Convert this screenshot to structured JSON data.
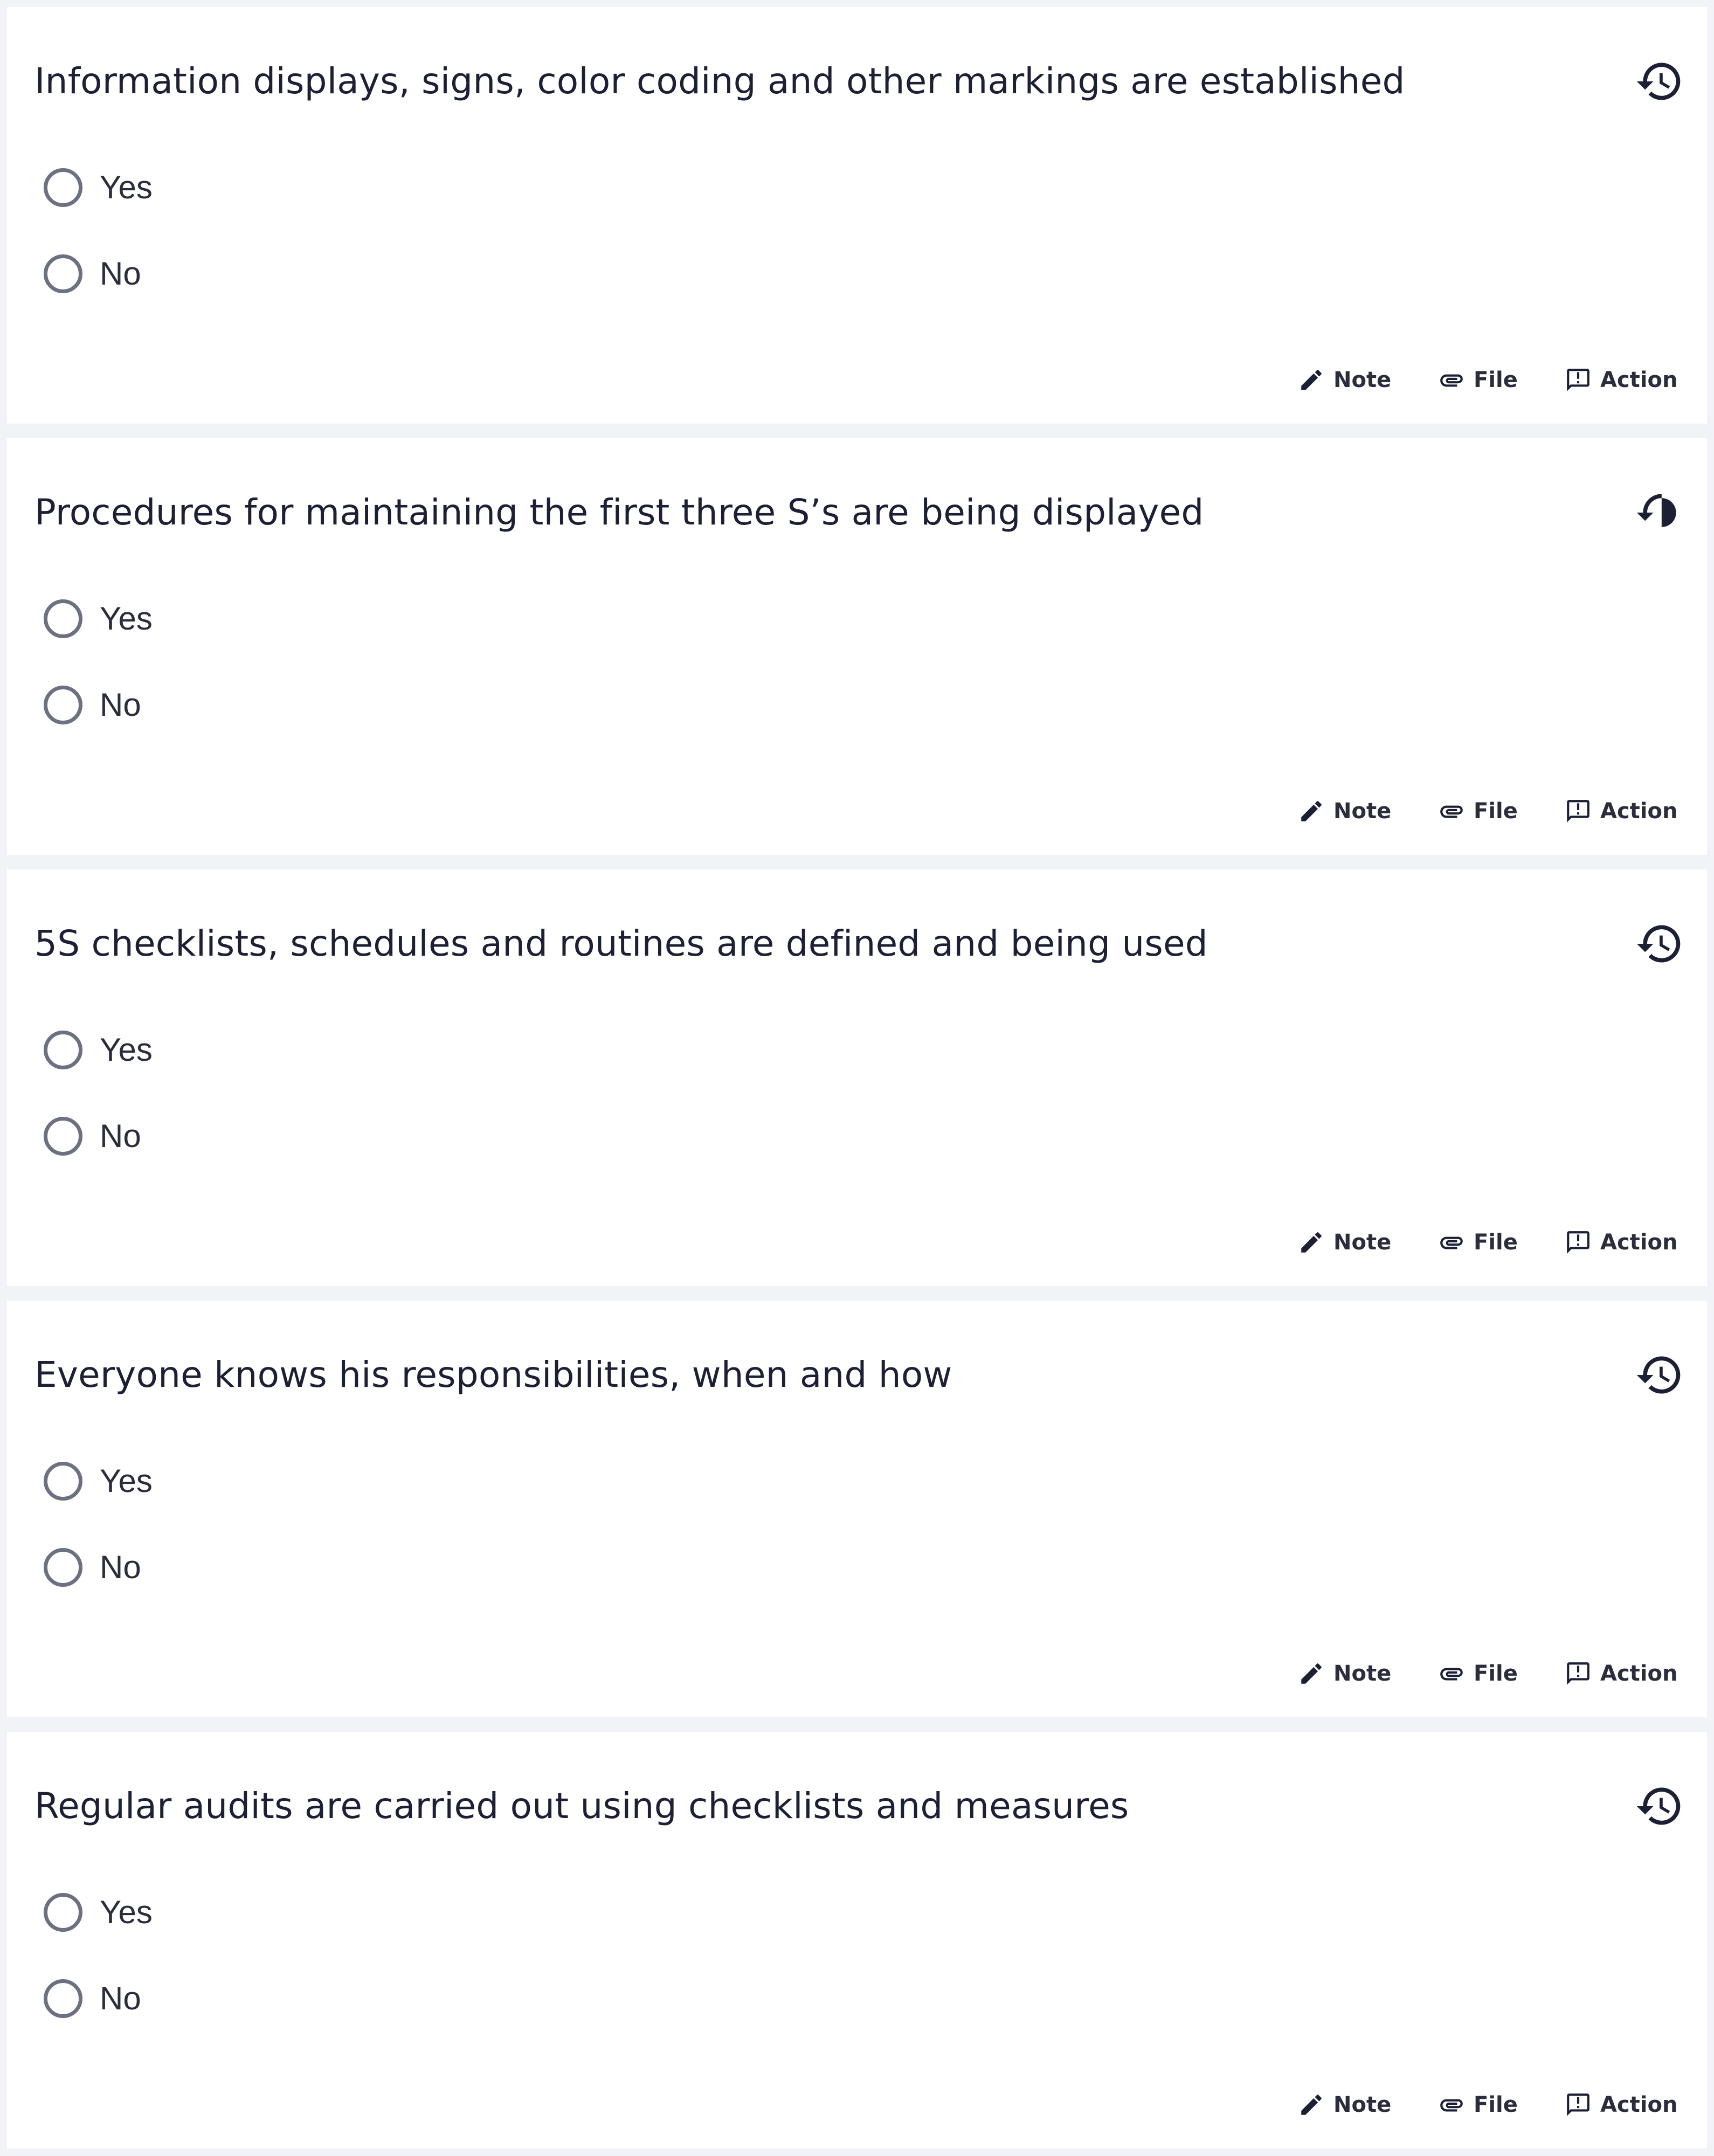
{
  "questions": [
    {
      "title": "Information displays, signs, color coding and other markings are established",
      "options": [
        "Yes",
        "No"
      ]
    },
    {
      "title": "Procedures for maintaining the first three S’s are being displayed",
      "options": [
        "Yes",
        "No"
      ]
    },
    {
      "title": "5S checklists, schedules and routines are defined and being used",
      "options": [
        "Yes",
        "No"
      ]
    },
    {
      "title": "Everyone knows his responsibilities, when and how",
      "options": [
        "Yes",
        "No"
      ]
    },
    {
      "title": "Regular audits are carried out using checklists and measures",
      "options": [
        "Yes",
        "No"
      ]
    }
  ],
  "actions": {
    "note_label": "Note",
    "file_label": "File",
    "action_label": "Action"
  },
  "icons": {
    "history": "history-icon",
    "note": "pencil-icon",
    "file": "paperclip-icon",
    "action": "report-comment-icon"
  },
  "colors": {
    "background": "#f2f3f7",
    "card": "#ffffff",
    "text": "#1d2035",
    "radio_border": "#6c7080"
  }
}
